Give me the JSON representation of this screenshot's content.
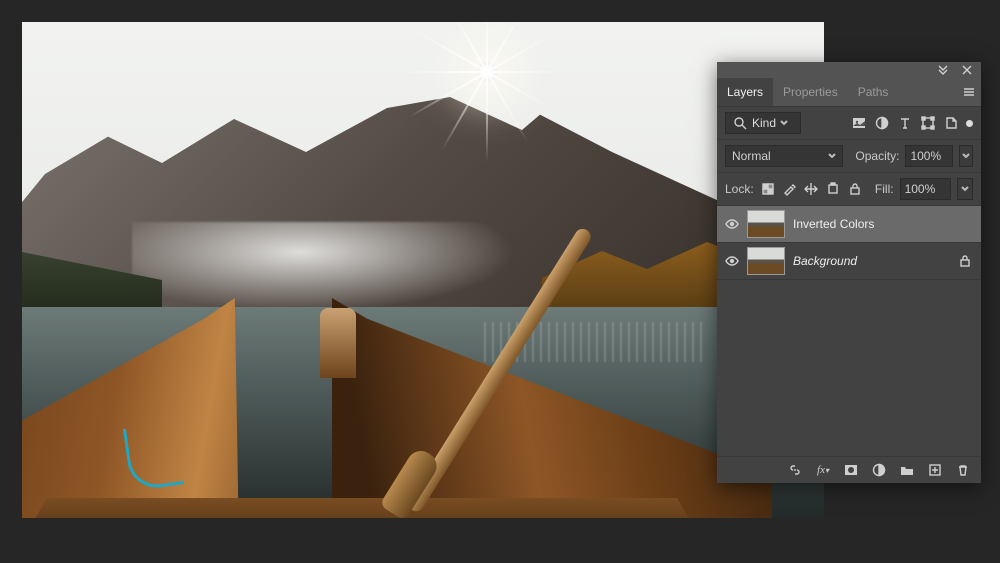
{
  "panel": {
    "tabs": [
      "Layers",
      "Properties",
      "Paths"
    ],
    "activeTab": 0,
    "filterLabel": "Kind",
    "blendMode": "Normal",
    "opacityLabel": "Opacity:",
    "opacityValue": "100%",
    "lockLabel": "Lock:",
    "fillLabel": "Fill:",
    "fillValue": "100%"
  },
  "layers": [
    {
      "name": "Inverted Colors",
      "italic": false,
      "selected": true,
      "locked": false
    },
    {
      "name": "Background",
      "italic": true,
      "selected": false,
      "locked": true
    }
  ],
  "icons": {
    "filterTypes": [
      "image-filter-icon",
      "adjustment-filter-icon",
      "type-filter-icon",
      "shape-filter-icon",
      "smartobject-filter-icon",
      "artboard-filter-icon"
    ],
    "lockTypes": [
      "lock-transparency-icon",
      "lock-paint-icon",
      "lock-position-icon",
      "lock-artboard-icon",
      "lock-all-icon"
    ],
    "bottom": [
      "link-layers-icon",
      "fx-icon",
      "layer-mask-icon",
      "adjustment-layer-icon",
      "group-icon",
      "new-layer-icon",
      "delete-layer-icon"
    ]
  }
}
